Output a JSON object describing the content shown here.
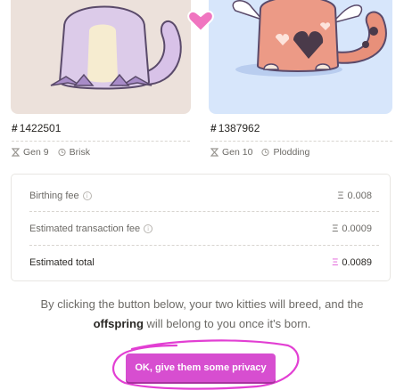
{
  "kitties": [
    {
      "id": "1422501",
      "generation": "Gen 9",
      "cooldown": "Brisk"
    },
    {
      "id": "1387962",
      "generation": "Gen 10",
      "cooldown": "Plodding"
    }
  ],
  "fees": {
    "birthing_label": "Birthing fee",
    "birthing_value": "0.008",
    "transaction_label": "Estimated transaction fee",
    "transaction_value": "0.0009",
    "total_label": "Estimated total",
    "total_value": "0.0089",
    "currency_symbol": "Ξ"
  },
  "explanation": {
    "before": "By clicking the button below, your two kitties will breed, and the",
    "bold": "offspring",
    "after": "will belong to you once it's born."
  },
  "cta": {
    "label": "OK, give them some privacy"
  },
  "colors": {
    "accent": "#d74ed0",
    "heart": "#f075c0",
    "left_bg": "#ece1db",
    "right_bg": "#d7e6fb"
  }
}
